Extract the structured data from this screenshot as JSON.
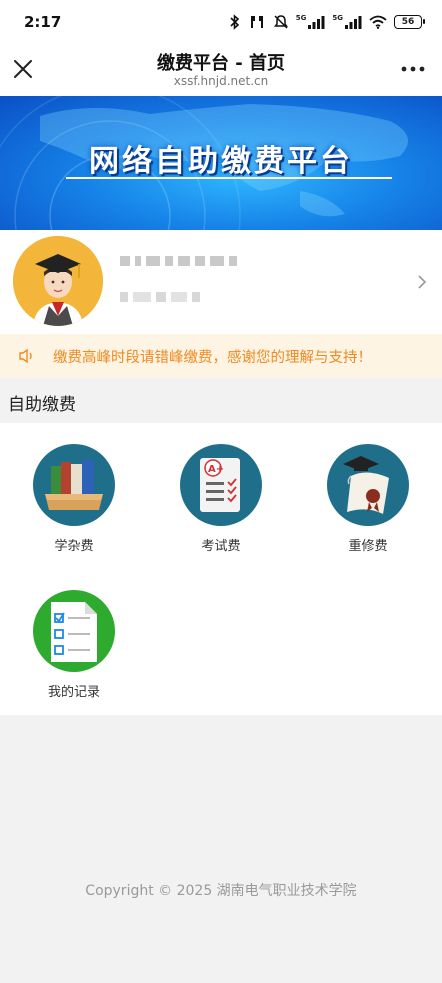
{
  "status_bar": {
    "time": "2:17",
    "signal_label_1": "5G",
    "signal_label_2": "5G",
    "battery": "56"
  },
  "nav": {
    "title": "缴费平台 - 首页",
    "url": "xssf.hnjd.net.cn"
  },
  "banner": {
    "text": "网络自助缴费平台"
  },
  "notice": {
    "text": "缴费高峰时段请错峰缴费，感谢您的理解与支持！",
    "color": "#f08a21"
  },
  "section": {
    "title": "自助缴费"
  },
  "services": [
    {
      "label": "学杂费",
      "icon": "books-icon",
      "color": "#1f6f8b"
    },
    {
      "label": "考试费",
      "icon": "exam-paper-icon",
      "color": "#1f6f8b"
    },
    {
      "label": "重修费",
      "icon": "diploma-icon",
      "color": "#1f6f8b"
    },
    {
      "label": "我的记录",
      "icon": "checklist-icon",
      "color": "#2eaa2e"
    }
  ],
  "footer": {
    "text": "Copyright © 2025  湖南电气职业技术学院"
  }
}
